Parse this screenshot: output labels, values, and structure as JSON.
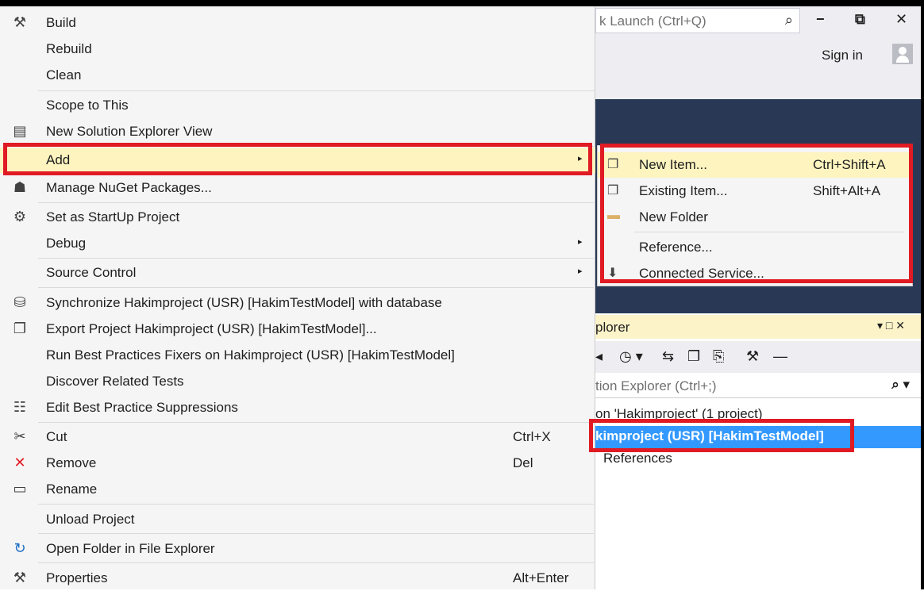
{
  "window": {
    "quick_launch_placeholder": "k Launch (Ctrl+Q)",
    "search_icon": "⌕",
    "minimize": "−",
    "restore": "⧉",
    "close": "✕",
    "sign_in": "Sign in"
  },
  "context_menu": {
    "items": [
      {
        "label": "Build",
        "icon": "build-icon",
        "glyph": "⚒"
      },
      {
        "label": "Rebuild"
      },
      {
        "label": "Clean"
      },
      {
        "label": "Scope to This"
      },
      {
        "label": "New Solution Explorer View",
        "icon": "solution-view-icon",
        "glyph": "▤"
      },
      {
        "label": "Add",
        "arrow": "▸"
      },
      {
        "label": "Manage NuGet Packages...",
        "icon": "nuget-icon",
        "glyph": "☗"
      },
      {
        "label": "Set as StartUp Project",
        "icon": "gear-icon",
        "glyph": "⚙"
      },
      {
        "label": "Debug",
        "arrow": "▸"
      },
      {
        "label": "Source Control",
        "arrow": "▸"
      },
      {
        "label": "Synchronize Hakimproject (USR) [HakimTestModel] with database",
        "icon": "sync-database-icon",
        "glyph": "⛁"
      },
      {
        "label": "Export Project Hakimproject (USR) [HakimTestModel]...",
        "icon": "export-icon",
        "glyph": "❐"
      },
      {
        "label": "Run Best Practices Fixers on Hakimproject (USR) [HakimTestModel]"
      },
      {
        "label": "Discover Related Tests"
      },
      {
        "label": "Edit Best Practice Suppressions",
        "icon": "suppressions-icon",
        "glyph": "☷"
      },
      {
        "label": "Cut",
        "shortcut": "Ctrl+X",
        "icon": "cut-icon",
        "glyph": "✂"
      },
      {
        "label": "Remove",
        "shortcut": "Del",
        "icon": "remove-icon",
        "glyph": "✕"
      },
      {
        "label": "Rename",
        "icon": "rename-icon",
        "glyph": "▭"
      },
      {
        "label": "Unload Project"
      },
      {
        "label": "Open Folder in File Explorer",
        "icon": "open-folder-icon",
        "glyph": "↻"
      },
      {
        "label": "Properties",
        "shortcut": "Alt+Enter",
        "icon": "wrench-icon",
        "glyph": "⚒"
      }
    ]
  },
  "add_submenu": {
    "items": [
      {
        "label": "New Item...",
        "shortcut": "Ctrl+Shift+A",
        "glyph": "❐"
      },
      {
        "label": "Existing Item...",
        "shortcut": "Shift+Alt+A",
        "glyph": "❐"
      },
      {
        "label": "New Folder",
        "glyph": "▬"
      },
      {
        "label": "Reference...",
        "glyph": ""
      },
      {
        "label": "Connected Service...",
        "glyph": "⬇"
      }
    ]
  },
  "solution_explorer": {
    "title": "plorer",
    "header_controls": "▾ □ ✕",
    "toolbar": [
      "◂",
      "◷ ▾",
      "⇆",
      "❐",
      "⎘",
      "⚒",
      "—"
    ],
    "search_placeholder": "tion Explorer (Ctrl+;)",
    "search_icon": "⌕ ▾",
    "solution_node": "on 'Hakimproject' (1 project)",
    "project_node": "kimproject (USR) [HakimTestModel]",
    "references_node": "References"
  },
  "colors": {
    "highlight_box": "#e01b24",
    "menu_hover": "#fdf4bf",
    "selection": "#3399ff"
  }
}
